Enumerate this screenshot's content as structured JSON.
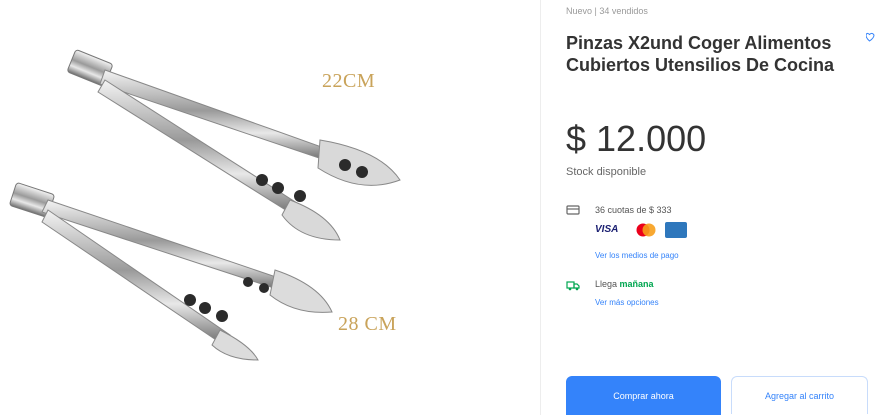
{
  "product": {
    "condition": "Nuevo | 34 vendidos",
    "title": "Pinzas X2und Coger Alimentos Cubiertos Utensilios De Cocina",
    "price": "$ 12.000",
    "stock": "Stock disponible"
  },
  "payment": {
    "installments": "36 cuotas de $ 333",
    "cards": {
      "visa": "VISA"
    },
    "methods_link": "Ver los medios de pago"
  },
  "shipping": {
    "arrival_prefix": "Llega",
    "arrival_day": "mañana",
    "options_link": "Ver más opciones"
  },
  "gallery": {
    "label_top": "22CM",
    "label_bottom": "28 CM"
  },
  "actions": {
    "buy_now": "Comprar ahora",
    "add_to_cart": "Agregar al carrito"
  },
  "colors": {
    "accent": "#3483fa",
    "success": "#00a650",
    "size_label": "#c9a35a"
  },
  "icons": {
    "installments": "credit-card-icon",
    "shipping": "truck-icon",
    "favorite": "heart-icon"
  }
}
